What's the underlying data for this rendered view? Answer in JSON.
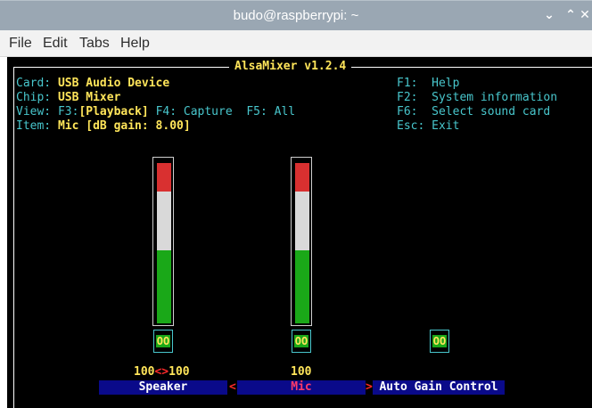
{
  "window": {
    "title": "budo@raspberrypi: ~"
  },
  "menu": {
    "file": "File",
    "edit": "Edit",
    "tabs": "Tabs",
    "help": "Help"
  },
  "alsamixer": {
    "title": "AlsaMixer v1.2.4",
    "card_label": "Card:",
    "card_value": "USB Audio Device",
    "chip_label": "Chip:",
    "chip_value": "USB Mixer",
    "view_label": "View:",
    "view_f3": "F3:",
    "view_playback": "[Playback]",
    "view_f4": "F4: Capture",
    "view_f5": "F5: All",
    "item_label": "Item:",
    "item_value": "Mic [dB gain: 8.00]",
    "keys": [
      {
        "key": "F1:",
        "desc": "Help"
      },
      {
        "key": "F2:",
        "desc": "System information"
      },
      {
        "key": "F6:",
        "desc": "Select sound card"
      },
      {
        "key": "Esc:",
        "desc": "Exit"
      }
    ],
    "controls": [
      {
        "name": "Speaker",
        "level": 100,
        "volume_text_left": "100",
        "volume_sep": "<>",
        "volume_text_right": "100",
        "badge": "OO"
      },
      {
        "name": "Mic",
        "level": 100,
        "volume_text": "100",
        "badge": "OO",
        "selected": true
      },
      {
        "name": "Auto Gain Control",
        "badge": "OO"
      }
    ],
    "arrow_left": "<",
    "arrow_right": ">"
  },
  "colors": {
    "green": "#1aa818",
    "red": "#d93030",
    "white": "#d9d9d9",
    "cyan": "#48c6cc",
    "yellow": "#ffe55a",
    "blue": "#0a0a8a"
  }
}
